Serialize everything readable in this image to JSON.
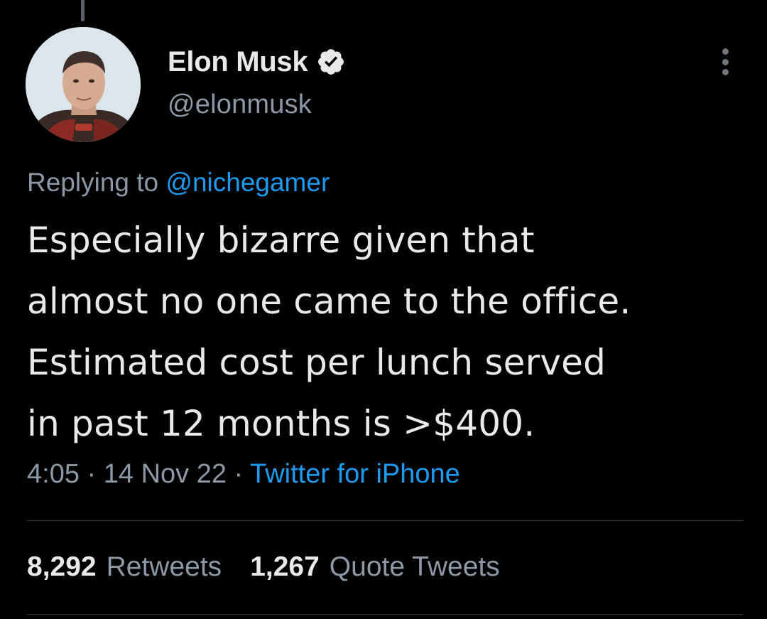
{
  "tweet": {
    "author": {
      "display_name": "Elon Musk",
      "handle": "@elonmusk",
      "verified": true
    },
    "reply_to": {
      "prefix": "Replying to",
      "handle": "@nichegamer"
    },
    "text_lines": [
      "Especially bizarre given that",
      "almost no one came to the office.",
      "Estimated cost per lunch served",
      "in past 12 months is >$400."
    ],
    "meta": {
      "time": "4:05",
      "separator": "·",
      "date": "14 Nov 22",
      "source": "Twitter for iPhone"
    },
    "stats": {
      "retweets_count": "8,292",
      "retweets_label": "Retweets",
      "quotes_count": "1,267",
      "quotes_label": "Quote Tweets"
    }
  },
  "icons": {
    "verified": "verified-badge-icon",
    "more": "more-options-icon"
  },
  "colors": {
    "background": "#000000",
    "text": "#e7e9ea",
    "secondary_text": "#8b98a5",
    "link": "#1d9bf0",
    "divider": "#2f3336"
  }
}
